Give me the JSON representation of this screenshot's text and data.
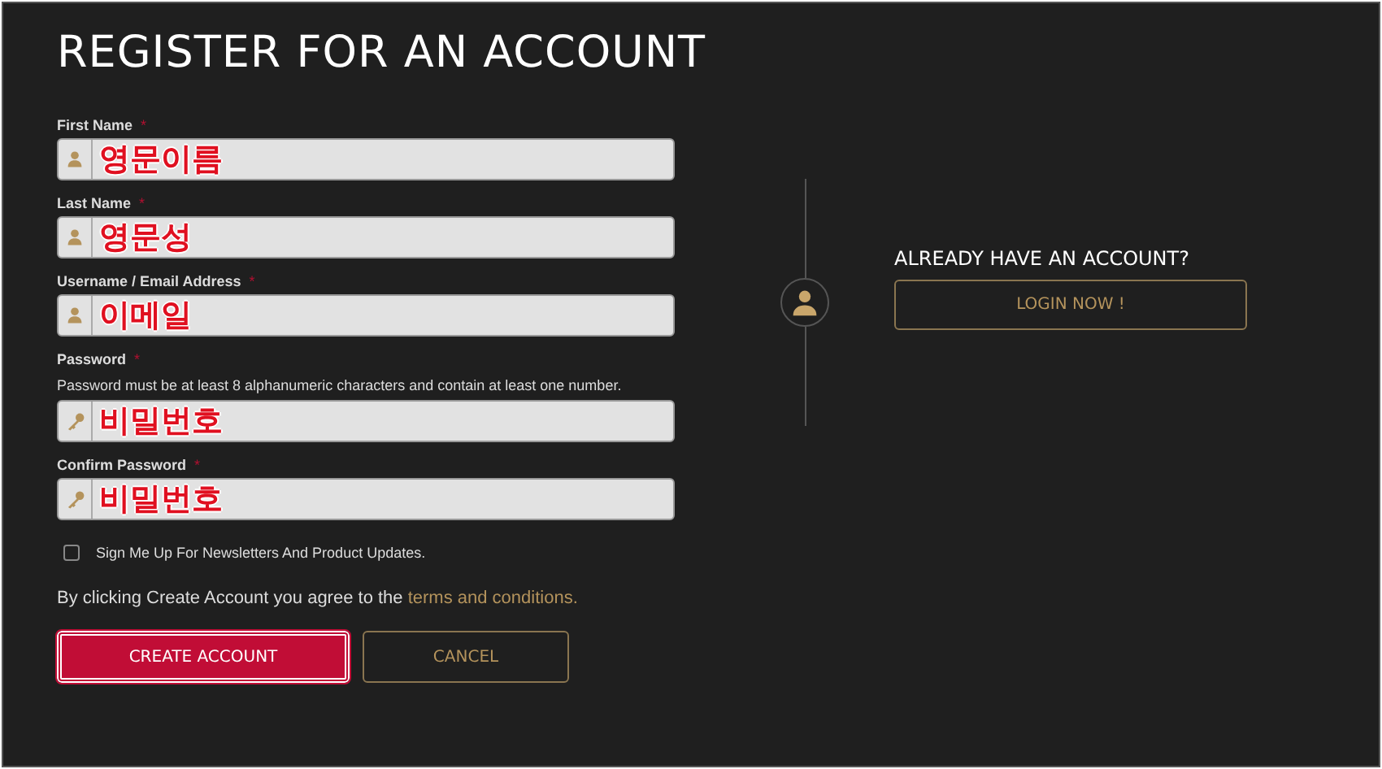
{
  "title": "REGISTER FOR AN ACCOUNT",
  "fields": [
    {
      "label": "First Name",
      "required": "*",
      "kind": "user",
      "value": "영문이름"
    },
    {
      "label": "Last Name",
      "required": "*",
      "kind": "user",
      "value": "영문성"
    },
    {
      "label": "Username / Email Address",
      "required": "*",
      "kind": "user",
      "value": "이메일"
    },
    {
      "label": "Password",
      "required": "*",
      "hint": "Password must be at least 8 alphanumeric characters and contain at least one number.",
      "kind": "key",
      "value": "비밀번호"
    },
    {
      "label": "Confirm Password",
      "required": "*",
      "kind": "key",
      "value": "비밀번호"
    }
  ],
  "newsletter": {
    "label": "Sign Me Up For Newsletters And Product Updates.",
    "checked": false
  },
  "terms": {
    "text": "By clicking Create Account you agree to the",
    "link": "terms and conditions."
  },
  "buttons": [
    {
      "label": "CREATE ACCOUNT",
      "kind": "primary"
    },
    {
      "label": "CANCEL",
      "kind": "outline"
    }
  ],
  "login": {
    "heading": "ALREADY HAVE AN ACCOUNT?",
    "button": "LOGIN NOW !"
  }
}
